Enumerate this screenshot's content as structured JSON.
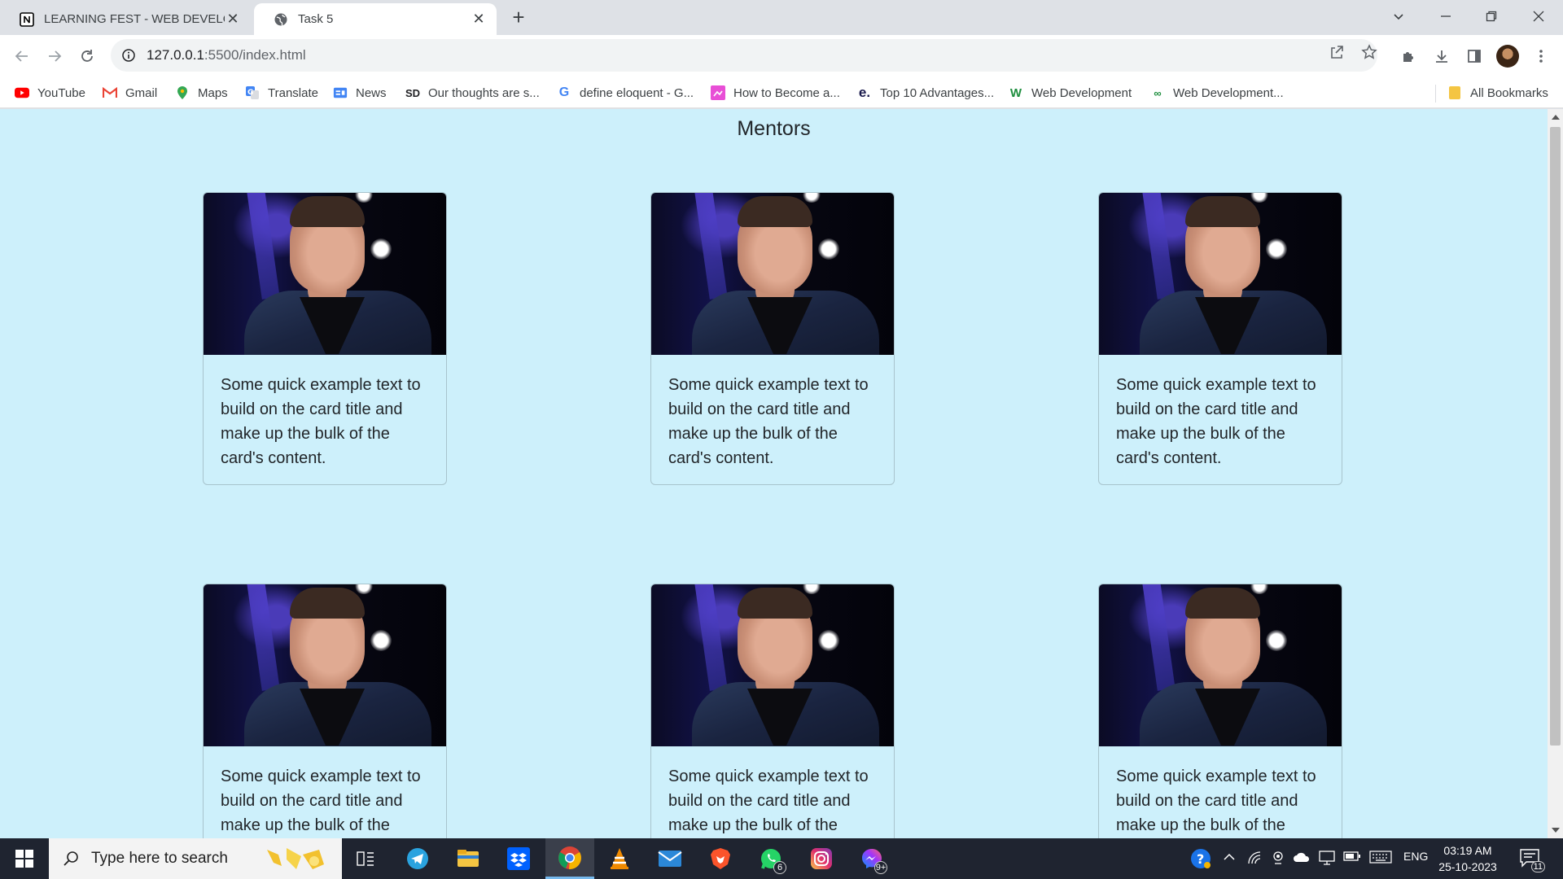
{
  "browser": {
    "tabs": [
      {
        "title": "LEARNING FEST - WEB DEVELOP",
        "active": false,
        "icon": "notion-icon"
      },
      {
        "title": "Task 5",
        "active": true,
        "icon": "globe-icon"
      }
    ],
    "address": {
      "host": "127.0.0.1",
      "path": ":5500/index.html"
    },
    "bookmarks": [
      {
        "label": "YouTube",
        "icon": "youtube-icon"
      },
      {
        "label": "Gmail",
        "icon": "gmail-icon"
      },
      {
        "label": "Maps",
        "icon": "maps-icon"
      },
      {
        "label": "Translate",
        "icon": "translate-icon"
      },
      {
        "label": "News",
        "icon": "news-icon"
      },
      {
        "label": "Our thoughts are s...",
        "icon": "sd-icon"
      },
      {
        "label": "define eloquent - G...",
        "icon": "google-icon"
      },
      {
        "label": "How to Become a...",
        "icon": "bookmark-icon"
      },
      {
        "label": "Top 10 Advantages...",
        "icon": "e-icon"
      },
      {
        "label": "Web Development",
        "icon": "w-icon"
      },
      {
        "label": "Web Development...",
        "icon": "link-icon"
      }
    ],
    "all_bookmarks": "All Bookmarks"
  },
  "page": {
    "heading": "Mentors",
    "cards": [
      {
        "text": "Some quick example text to build on the card title and make up the bulk of the card's content."
      },
      {
        "text": "Some quick example text to build on the card title and make up the bulk of the card's content."
      },
      {
        "text": "Some quick example text to build on the card title and make up the bulk of the card's content."
      },
      {
        "text": "Some quick example text to build on the card title and make up the bulk of the card's content."
      },
      {
        "text": "Some quick example text to build on the card title and make up the bulk of the card's content."
      },
      {
        "text": "Some quick example text to build on the card title and make up the bulk of the card's content."
      }
    ]
  },
  "taskbar": {
    "search_placeholder": "Type here to search",
    "apps": [
      {
        "name": "task-view-icon"
      },
      {
        "name": "telegram-icon"
      },
      {
        "name": "file-explorer-icon"
      },
      {
        "name": "dropbox-icon"
      },
      {
        "name": "chrome-icon",
        "active": true
      },
      {
        "name": "vlc-icon"
      },
      {
        "name": "mail-icon"
      },
      {
        "name": "brave-icon"
      },
      {
        "name": "whatsapp-icon",
        "badge": "6"
      },
      {
        "name": "instagram-icon"
      },
      {
        "name": "messenger-icon",
        "badge": "9+"
      }
    ],
    "language": "ENG",
    "time": "03:19 AM",
    "date": "25-10-2023",
    "notification_count": "11"
  },
  "colors": {
    "page_background": "#cdf0fb",
    "taskbar": "#1f2430",
    "chrome_frame": "#dee1e6"
  }
}
